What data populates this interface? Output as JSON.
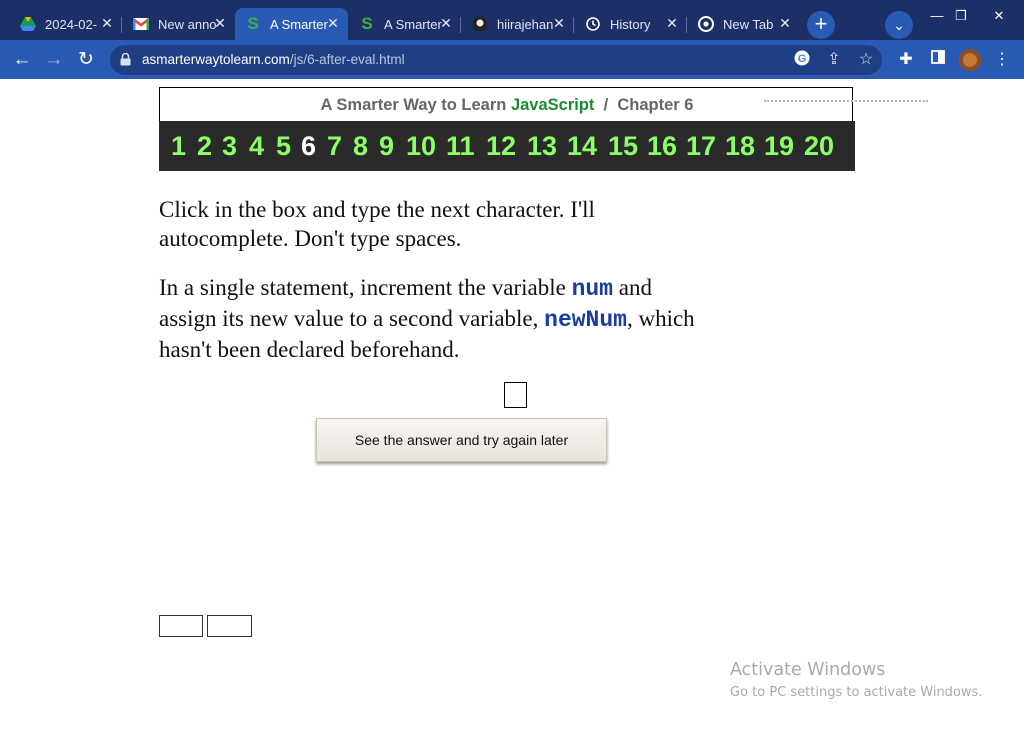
{
  "browser": {
    "tabs": [
      {
        "label": "2024-02-",
        "icon": "google-drive-icon",
        "icon_color": "#f4b400",
        "active": false
      },
      {
        "label": "New anno",
        "icon": "gmail-icon",
        "icon_color": "#ea4335",
        "active": false
      },
      {
        "label": "A Smarter",
        "icon": "smarterway-s-icon",
        "icon_color": "#3cb043",
        "active": true
      },
      {
        "label": "A Smarter",
        "icon": "smarterway-s-icon",
        "icon_color": "#3cb043",
        "active": false
      },
      {
        "label": "hiirajehan",
        "icon": "github-icon",
        "icon_color": "#ffffff",
        "active": false
      },
      {
        "label": "History",
        "icon": "history-icon",
        "icon_color": "#ffffff",
        "active": false
      },
      {
        "label": "New Tab",
        "icon": "chrome-icon",
        "icon_color": "#ffffff",
        "active": false
      }
    ],
    "url_domain": "asmarterwaytolearn.com",
    "url_path": "/js/6-after-eval.html"
  },
  "page": {
    "header_prefix": "A Smarter Way to Learn",
    "header_lang": "JavaScript",
    "header_sep": "/",
    "header_chapter": "Chapter 6",
    "chapters": [
      "1",
      "2",
      "3",
      "4",
      "5",
      "6",
      "7",
      "8",
      "9",
      "10",
      "11",
      "12",
      "13",
      "14",
      "15",
      "16",
      "17",
      "18",
      "19",
      "20"
    ],
    "current_chapter": "6",
    "instruction_line1": "Click in the box and type the next character. I'll",
    "instruction_line2": "autocomplete. Don't type spaces.",
    "task_part1": "In a single statement, increment the variable",
    "task_var1": "num",
    "task_part2": "and",
    "task_part3": "assign its new value to a second variable,",
    "task_var2": "newNum",
    "task_part4": ", which",
    "task_part5": "hasn't been declared beforehand.",
    "answer_button": "See the answer and try again later"
  },
  "watermark": {
    "title": "Activate Windows",
    "subtitle": "Go to PC settings to activate Windows."
  },
  "colors": {
    "browser_frame": "#1c2f66",
    "browser_toolbar": "#2a5bb4",
    "chapter_bar": "#2a2a2a",
    "chapter_link": "#8cff66",
    "js_green": "#1a8b2e",
    "code_blue": "#1a3c9a"
  }
}
